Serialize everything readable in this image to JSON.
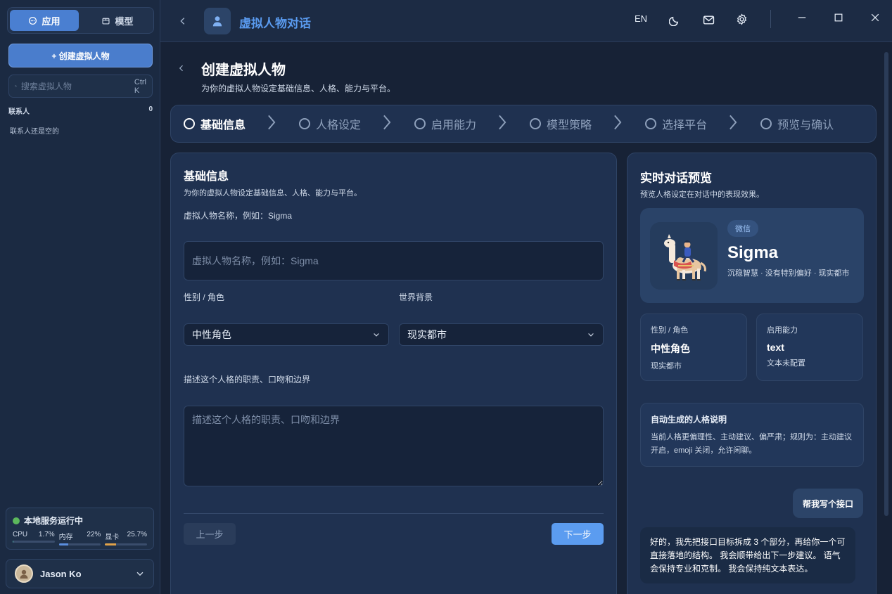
{
  "sidebar": {
    "tabs": [
      {
        "label": "应用",
        "icon": "chat-icon"
      },
      {
        "label": "模型",
        "icon": "box-icon"
      }
    ],
    "create_label": "+ 创建虚拟人物",
    "search_placeholder": "搜索虚拟人物",
    "search_shortcut": "Ctrl K",
    "contacts_label": "联系人",
    "contacts_count": "0",
    "contacts_empty": "联系人还是空的",
    "status": {
      "title": "本地服务运行中",
      "metrics": [
        {
          "label": "CPU",
          "value": "1.7%",
          "fraction": 0.017,
          "color": "#4fb0a5"
        },
        {
          "label": "内存",
          "value": "22%",
          "fraction": 0.22,
          "color": "#5b8fe0"
        },
        {
          "label": "显卡",
          "value": "25.7%",
          "fraction": 0.257,
          "color": "#e0a24a"
        }
      ]
    },
    "user_name": "Jason Ko"
  },
  "topbar": {
    "app_title": "虚拟人物对话",
    "lang": "EN"
  },
  "page": {
    "title": "创建虚拟人物",
    "subtitle": "为你的虚拟人物设定基础信息、人格、能力与平台。",
    "steps": [
      "基础信息",
      "人格设定",
      "启用能力",
      "模型策略",
      "选择平台",
      "预览与确认"
    ],
    "active_step": 0
  },
  "form": {
    "title": "基础信息",
    "subtitle": "为你的虚拟人物设定基础信息、人格、能力与平台。",
    "name_label": "虚拟人物名称，例如：Sigma",
    "name_placeholder": "虚拟人物名称，例如：Sigma",
    "gender_label": "性别 / 角色",
    "gender_value": "中性角色",
    "world_label": "世界背景",
    "world_value": "现实都市",
    "desc_label": "描述这个人格的职责、口吻和边界",
    "desc_placeholder": "描述这个人格的职责、口吻和边界",
    "prev_label": "上一步",
    "next_label": "下一步"
  },
  "preview": {
    "title": "实时对话预览",
    "subtitle": "预览人格设定在对话中的表现效果。",
    "platform": "微信",
    "name": "Sigma",
    "desc": "沉稳智慧 · 没有特别偏好 · 现实都市",
    "card1": {
      "k": "性别 / 角色",
      "v": "中性角色",
      "s": "现实都市"
    },
    "card2": {
      "k": "启用能力",
      "v": "text",
      "s": "文本未配置"
    },
    "auto_title": "自动生成的人格说明",
    "auto_text": "当前人格更偏理性、主动建议、偏严肃；规则为：主动建议开启，emoji 关闭，允许闲聊。",
    "user_msg": "帮我写个接口",
    "bot_msg": "好的，我先把接口目标拆成 3 个部分，再给你一个可直接落地的结构。 我会顺带给出下一步建议。 语气会保持专业和克制。 我会保持纯文本表达。"
  }
}
